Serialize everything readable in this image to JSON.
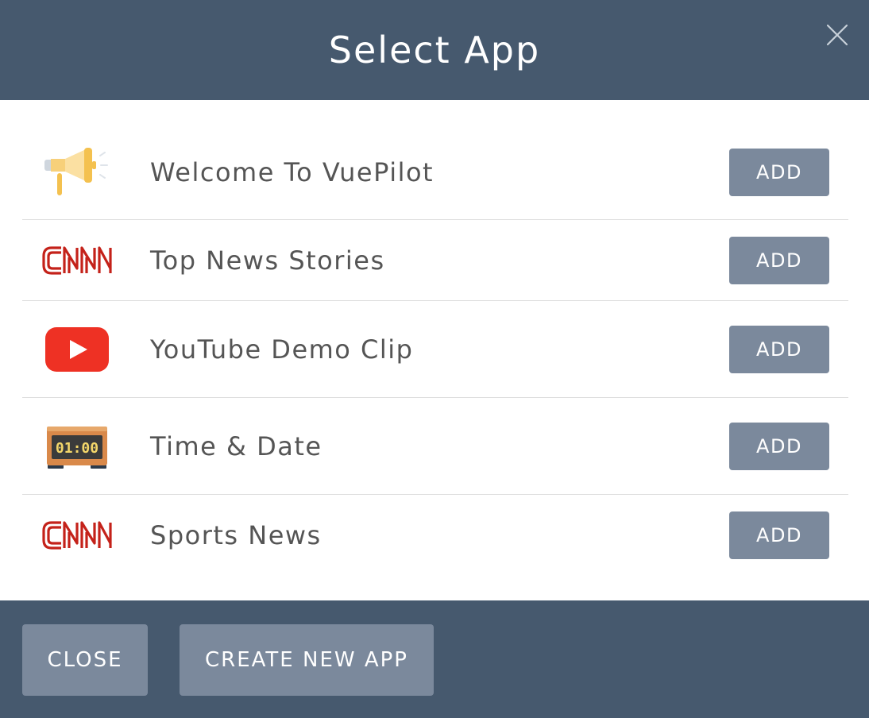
{
  "dialog": {
    "title": "Select App",
    "close_icon": "close-icon"
  },
  "apps": [
    {
      "label": "Welcome To VuePilot",
      "icon": "megaphone-icon",
      "action_label": "ADD"
    },
    {
      "label": "Top News Stories",
      "icon": "cnn-logo-icon",
      "action_label": "ADD"
    },
    {
      "label": "YouTube Demo Clip",
      "icon": "youtube-icon",
      "action_label": "ADD"
    },
    {
      "label": "Time & Date",
      "icon": "digital-clock-icon",
      "clock_text": "01:00",
      "action_label": "ADD"
    },
    {
      "label": "Sports News",
      "icon": "cnn-logo-icon",
      "action_label": "ADD"
    }
  ],
  "footer": {
    "close_label": "CLOSE",
    "create_label": "CREATE NEW APP"
  },
  "colors": {
    "header_bg": "#46596e",
    "button_bg": "#7b899c",
    "cnn_red": "#c4221a",
    "youtube_red": "#ee3124",
    "text": "#555555"
  }
}
